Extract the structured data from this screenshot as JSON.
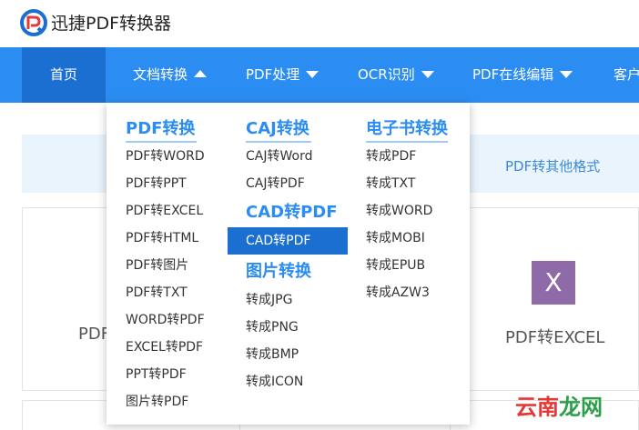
{
  "app": {
    "brand": "迅捷PDF转换器"
  },
  "nav": {
    "items": [
      {
        "label": "首页"
      },
      {
        "label": "文档转换"
      },
      {
        "label": "PDF处理"
      },
      {
        "label": "OCR识别"
      },
      {
        "label": "PDF在线编辑"
      },
      {
        "label": "客户"
      }
    ]
  },
  "banner": {
    "text": "PDF转其他格式"
  },
  "cards": {
    "left_label": "PDF",
    "right_label": "PDF转EXCEL",
    "excel_icon_letter": "X"
  },
  "dropdown": {
    "pdf": {
      "title": "PDF转换",
      "items": [
        "PDF转WORD",
        "PDF转PPT",
        "PDF转EXCEL",
        "PDF转HTML",
        "PDF转图片",
        "PDF转TXT",
        "WORD转PDF",
        "EXCEL转PDF",
        "PPT转PDF",
        "图片转PDF"
      ]
    },
    "caj": {
      "title": "CAJ转换",
      "items": [
        "CAJ转Word",
        "CAJ转PDF"
      ]
    },
    "cad": {
      "title": "CAD转PDF",
      "items": [
        "CAD转PDF"
      ]
    },
    "image": {
      "title": "图片转换",
      "items": [
        "转成JPG",
        "转成PNG",
        "转成BMP",
        "转成ICON"
      ]
    },
    "ebook": {
      "title": "电子书转换",
      "items": [
        "转成PDF",
        "转成TXT",
        "转成WORD",
        "转成MOBI",
        "转成EPUB",
        "转成AZW3"
      ]
    }
  },
  "watermark": {
    "red": "云南",
    "green": "龙网"
  },
  "colors": {
    "nav_bg": "#2b8df2",
    "nav_active": "#1a6fd0",
    "accent": "#2b8df2",
    "excel_icon": "#8e6aa9"
  }
}
